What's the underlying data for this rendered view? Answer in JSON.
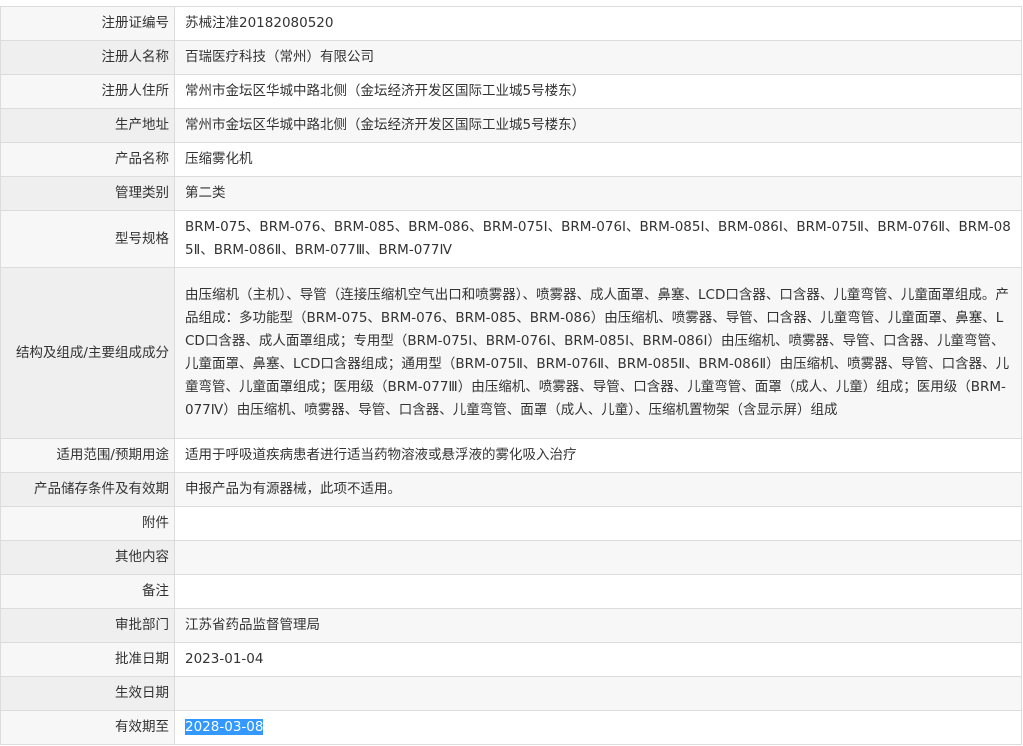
{
  "rows": [
    {
      "label": "注册证编号",
      "value": "苏械注准20182080520"
    },
    {
      "label": "注册人名称",
      "value": "百瑞医疗科技（常州）有限公司"
    },
    {
      "label": "注册人住所",
      "value": "常州市金坛区华城中路北侧（金坛经济开发区国际工业城5号楼东）"
    },
    {
      "label": "生产地址",
      "value": "常州市金坛区华城中路北侧（金坛经济开发区国际工业城5号楼东）"
    },
    {
      "label": "产品名称",
      "value": "压缩雾化机"
    },
    {
      "label": "管理类别",
      "value": "第二类"
    },
    {
      "label": "型号规格",
      "value": "BRM-075、BRM-076、BRM-085、BRM-086、BRM-075Ⅰ、BRM-076Ⅰ、BRM-085Ⅰ、BRM-086Ⅰ、BRM-075Ⅱ、BRM-076Ⅱ、BRM-085Ⅱ、BRM-086Ⅱ、BRM-077Ⅲ、BRM-077Ⅳ"
    },
    {
      "label": "结构及组成/主要组成成分",
      "value": "由压缩机（主机）、导管（连接压缩机空气出口和喷雾器）、喷雾器、成人面罩、鼻塞、LCD口含器、口含器、儿童弯管、儿童面罩组成。产品组成：多功能型（BRM-075、BRM-076、BRM-085、BRM-086）由压缩机、喷雾器、导管、口含器、儿童弯管、儿童面罩、鼻塞、LCD口含器、成人面罩组成；专用型（BRM-075Ⅰ、BRM-076Ⅰ、BRM-085Ⅰ、BRM-086Ⅰ）由压缩机、喷雾器、导管、口含器、儿童弯管、儿童面罩、鼻塞、LCD口含器组成；通用型（BRM-075Ⅱ、BRM-076Ⅱ、BRM-085Ⅱ、BRM-086Ⅱ）由压缩机、喷雾器、导管、口含器、儿童弯管、儿童面罩组成；医用级（BRM-077Ⅲ）由压缩机、喷雾器、导管、口含器、儿童弯管、面罩（成人、儿童）组成；医用级（BRM-077Ⅳ）由压缩机、喷雾器、导管、口含器、儿童弯管、面罩（成人、儿童）、压缩机置物架（含显示屏）组成"
    },
    {
      "label": "适用范围/预期用途",
      "value": "适用于呼吸道疾病患者进行适当药物溶液或悬浮液的雾化吸入治疗"
    },
    {
      "label": "产品储存条件及有效期",
      "value": "申报产品为有源器械，此项不适用。"
    },
    {
      "label": "附件",
      "value": ""
    },
    {
      "label": "其他内容",
      "value": ""
    },
    {
      "label": "备注",
      "value": ""
    },
    {
      "label": "审批部门",
      "value": "江苏省药品监督管理局"
    },
    {
      "label": "批准日期",
      "value": "2023-01-04"
    },
    {
      "label": "生效日期",
      "value": ""
    },
    {
      "label": "有效期至",
      "value": "2028-03-08"
    }
  ]
}
